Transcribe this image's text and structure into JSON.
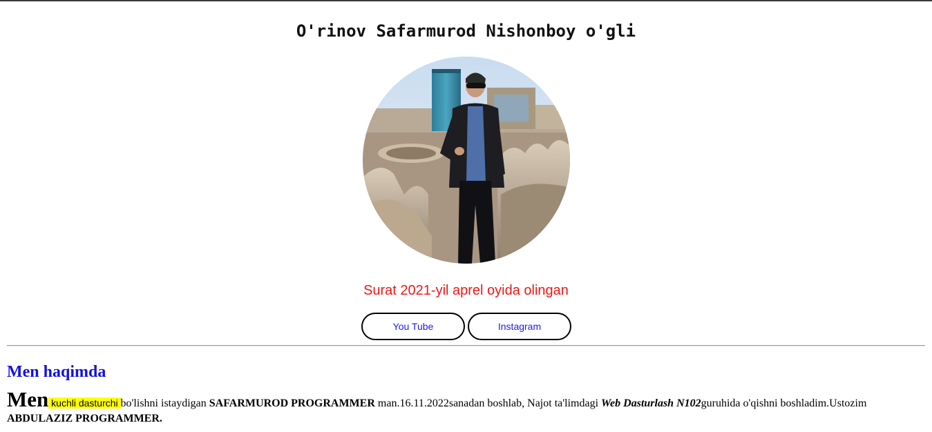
{
  "header": {
    "title": "O'rinov Safarmurod Nishonboy o'gli"
  },
  "photo": {
    "caption": "Surat 2021-yil aprel oyida olingan"
  },
  "social": {
    "youtube_label": "You Tube",
    "instagram_label": "Instagram"
  },
  "about": {
    "heading": "Men haqimda",
    "big_word": "Men",
    "highlight": " kuchli dasturchi ",
    "part1": " bo'lishni istaydigan ",
    "name_bold": "SAFARMUROD PROGRAMMER",
    "part2": " man.16.11.2022sanadan boshlab, Najot ta'limdagi ",
    "course_bold_italic": "Web Dasturlash N102",
    "part3": "guruhida o'qishni boshladim.Ustozim ",
    "teacher_bold": "ABDULAZIZ PROGRAMMER."
  },
  "colors": {
    "caption": "#f01515",
    "heading": "#1212e6",
    "link": "#1a1aee",
    "highlight": "#ffff00"
  }
}
